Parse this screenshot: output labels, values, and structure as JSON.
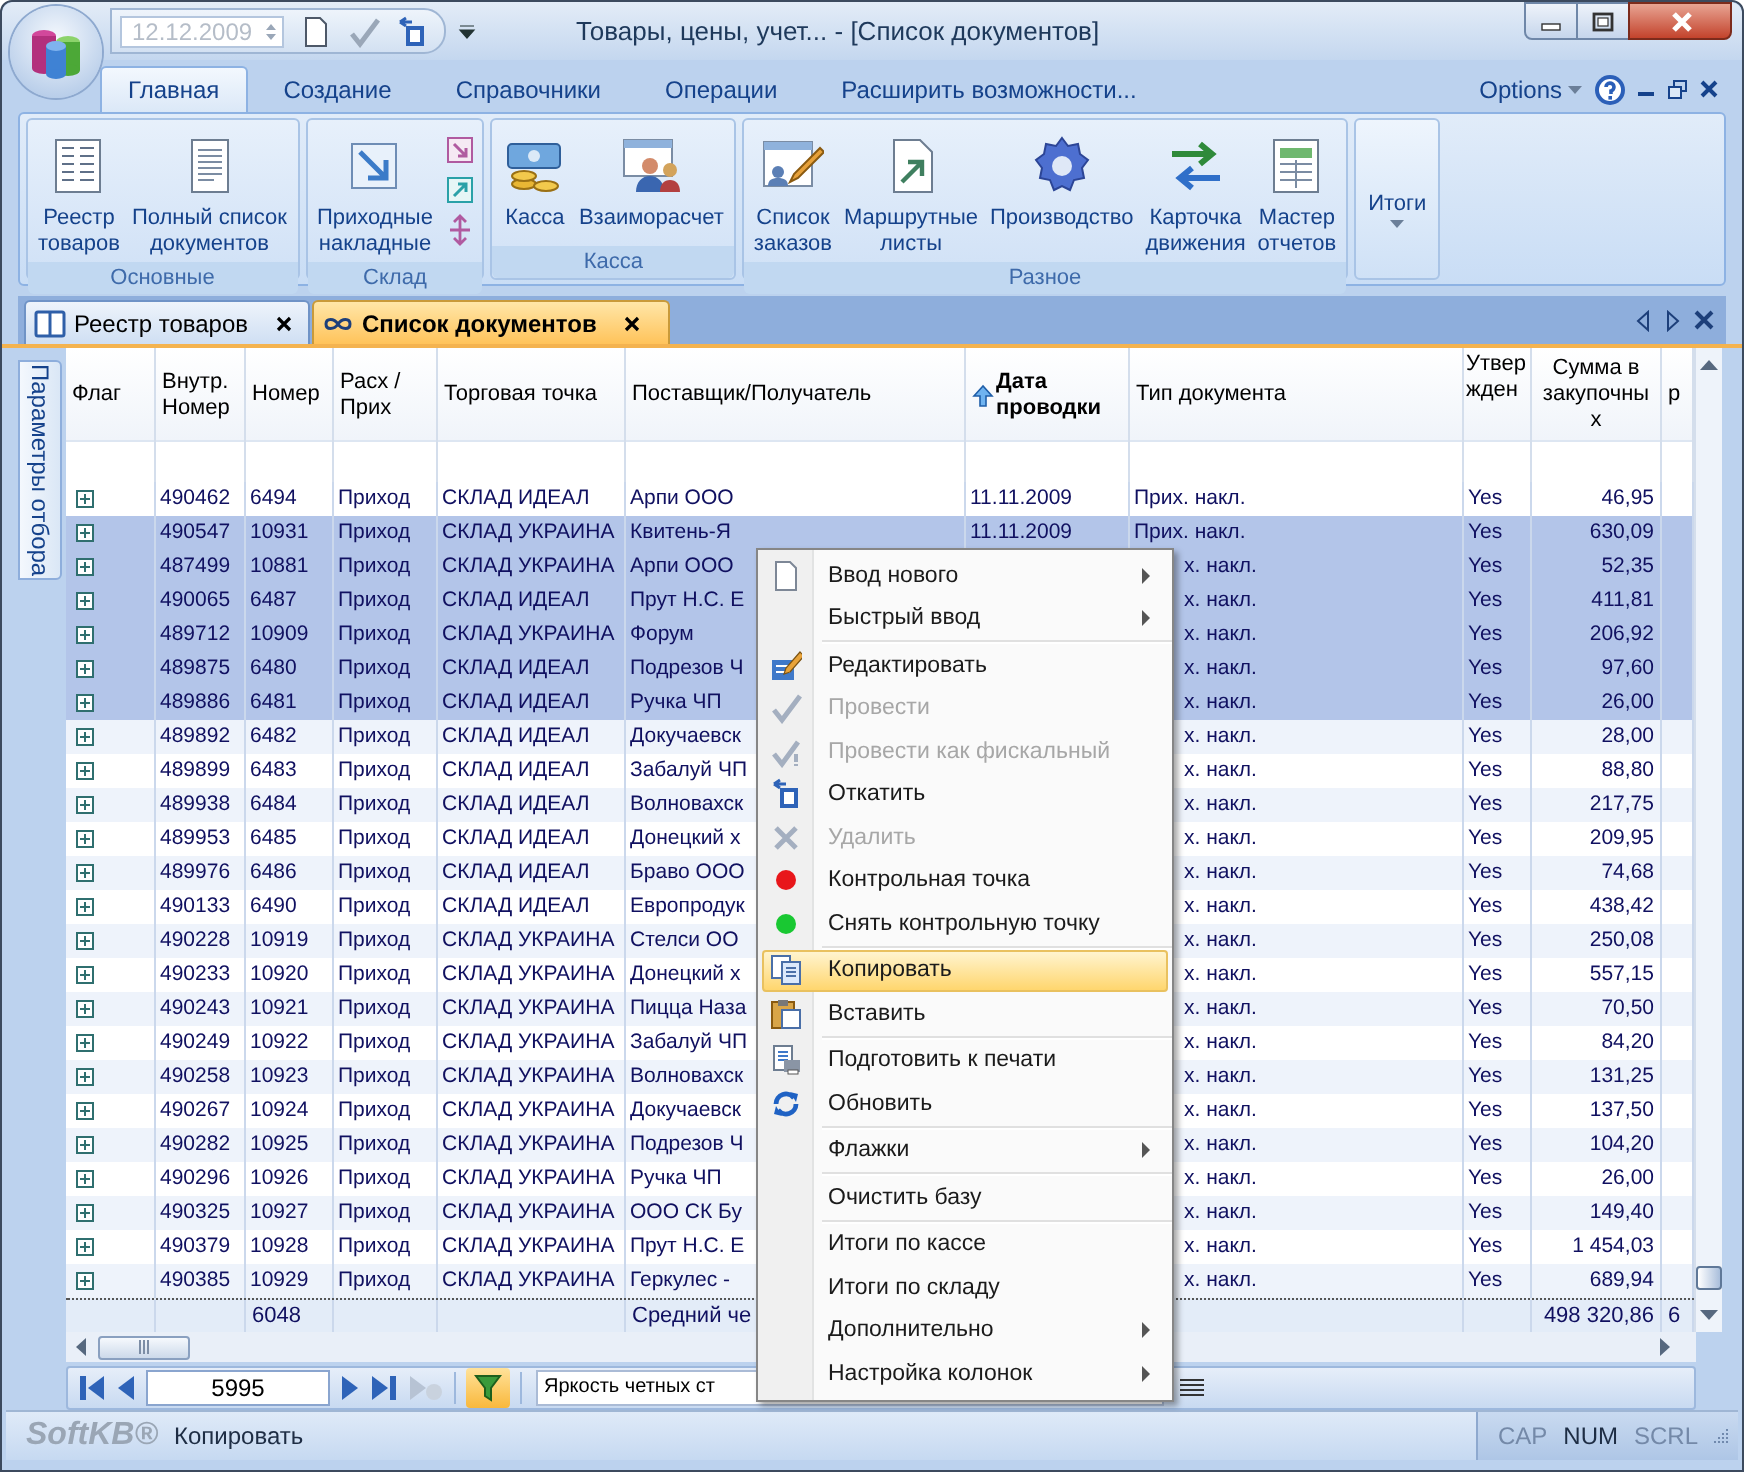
{
  "window": {
    "title": "Товары, цены, учет... - [Список документов]",
    "date_field": {
      "value": "12.12.2009",
      "disabled": true
    }
  },
  "ribbon": {
    "tabs": [
      {
        "label": "Главная",
        "selected": true
      },
      {
        "label": "Создание",
        "selected": false
      },
      {
        "label": "Справочники",
        "selected": false
      },
      {
        "label": "Операции",
        "selected": false
      },
      {
        "label": "Расширить возможности...",
        "selected": false
      }
    ],
    "options": "Options",
    "groups": [
      {
        "label": "Основные",
        "kind": "large",
        "buttons": [
          {
            "lines": [
              "Реестр",
              "товаров"
            ]
          },
          {
            "lines": [
              "Полный список",
              "документов"
            ]
          }
        ]
      },
      {
        "label": "Склад",
        "kind": "mixed",
        "buttons": [
          {
            "lines": [
              "Приходные",
              "накладные"
            ]
          }
        ]
      },
      {
        "label": "Касса",
        "kind": "large",
        "buttons": [
          {
            "lines": [
              "Касса"
            ]
          },
          {
            "lines": [
              "Взаиморасчет"
            ]
          }
        ]
      },
      {
        "label": "Разное",
        "kind": "large",
        "buttons": [
          {
            "lines": [
              "Список",
              "заказов"
            ]
          },
          {
            "lines": [
              "Маршрутные",
              "листы"
            ]
          },
          {
            "lines": [
              "Производство"
            ]
          },
          {
            "lines": [
              "Карточка",
              "движения"
            ]
          },
          {
            "lines": [
              "Мастер",
              "отчетов"
            ]
          }
        ]
      }
    ],
    "dropdown": {
      "label": "Итоги"
    }
  },
  "doc_tabs": [
    {
      "label": "Реестр товаров",
      "selected": false
    },
    {
      "label": "Список документов",
      "selected": true
    }
  ],
  "side_tab": "Параметры отбора",
  "table": {
    "columns": [
      {
        "label": "Флаг",
        "sorted": false
      },
      {
        "label": "Внутр. Номер",
        "sorted": false
      },
      {
        "label": "Номер",
        "sorted": false
      },
      {
        "label": "Расх / Прих",
        "sorted": false
      },
      {
        "label": "Торговая точка",
        "sorted": false
      },
      {
        "label": "Поставщик/Получатель",
        "sorted": false
      },
      {
        "label": "Дата проводки",
        "sorted": true
      },
      {
        "label": "Тип документа",
        "sorted": false
      },
      {
        "label": "Утвержден",
        "sorted": false
      },
      {
        "label": "Сумма в закупочных",
        "sorted": false
      },
      {
        "label": "р",
        "sorted": false
      }
    ],
    "rows": [
      {
        "selected": false,
        "internal_no": "490462",
        "number": "6494",
        "direction": "Приход",
        "store": "СКЛАД ИДЕАЛ",
        "partner": "Арпи ООО",
        "date": "11.11.2009",
        "doc_type": "Прих. накл.",
        "approved": "Yes",
        "sum": "46,95"
      },
      {
        "selected": true,
        "internal_no": "490547",
        "number": "10931",
        "direction": "Приход",
        "store": "СКЛАД УКРАИНА",
        "partner": "Квитень-Я",
        "date": "11.11.2009",
        "doc_type": "Прих. накл.",
        "approved": "Yes",
        "sum": "630,09"
      },
      {
        "selected": true,
        "internal_no": "487499",
        "number": "10881",
        "direction": "Приход",
        "store": "СКЛАД УКРАИНА",
        "partner": "Арпи ООО",
        "doc_type": "х. накл.",
        "approved": "Yes",
        "sum": "52,35"
      },
      {
        "selected": true,
        "internal_no": "490065",
        "number": "6487",
        "direction": "Приход",
        "store": "СКЛАД ИДЕАЛ",
        "partner": "Прут Н.С. Е",
        "doc_type": "х. накл.",
        "approved": "Yes",
        "sum": "411,81"
      },
      {
        "selected": true,
        "internal_no": "489712",
        "number": "10909",
        "direction": "Приход",
        "store": "СКЛАД УКРАИНА",
        "partner": "Форум",
        "doc_type": "х. накл.",
        "approved": "Yes",
        "sum": "206,92"
      },
      {
        "selected": true,
        "internal_no": "489875",
        "number": "6480",
        "direction": "Приход",
        "store": "СКЛАД ИДЕАЛ",
        "partner": "Подрезов Ч",
        "doc_type": "х. накл.",
        "approved": "Yes",
        "sum": "97,60"
      },
      {
        "selected": true,
        "internal_no": "489886",
        "number": "6481",
        "direction": "Приход",
        "store": "СКЛАД ИДЕАЛ",
        "partner": "Ручка ЧП",
        "doc_type": "х. накл.",
        "approved": "Yes",
        "sum": "26,00"
      },
      {
        "selected": false,
        "internal_no": "489892",
        "number": "6482",
        "direction": "Приход",
        "store": "СКЛАД ИДЕАЛ",
        "partner": "Докучаевск",
        "doc_type": "х. накл.",
        "approved": "Yes",
        "sum": "28,00"
      },
      {
        "selected": false,
        "internal_no": "489899",
        "number": "6483",
        "direction": "Приход",
        "store": "СКЛАД ИДЕАЛ",
        "partner": "Забалуй ЧП",
        "doc_type": "х. накл.",
        "approved": "Yes",
        "sum": "88,80"
      },
      {
        "selected": false,
        "internal_no": "489938",
        "number": "6484",
        "direction": "Приход",
        "store": "СКЛАД ИДЕАЛ",
        "partner": "Волновахск",
        "doc_type": "х. накл.",
        "approved": "Yes",
        "sum": "217,75"
      },
      {
        "selected": false,
        "internal_no": "489953",
        "number": "6485",
        "direction": "Приход",
        "store": "СКЛАД ИДЕАЛ",
        "partner": "Донецкий х",
        "doc_type": "х. накл.",
        "approved": "Yes",
        "sum": "209,95"
      },
      {
        "selected": false,
        "internal_no": "489976",
        "number": "6486",
        "direction": "Приход",
        "store": "СКЛАД ИДЕАЛ",
        "partner": "Браво ООО",
        "doc_type": "х. накл.",
        "approved": "Yes",
        "sum": "74,68"
      },
      {
        "selected": false,
        "internal_no": "490133",
        "number": "6490",
        "direction": "Приход",
        "store": "СКЛАД ИДЕАЛ",
        "partner": "Европродук",
        "doc_type": "х. накл.",
        "approved": "Yes",
        "sum": "438,42"
      },
      {
        "selected": false,
        "internal_no": "490228",
        "number": "10919",
        "direction": "Приход",
        "store": "СКЛАД УКРАИНА",
        "partner": "Стелси ОО",
        "doc_type": "х. накл.",
        "approved": "Yes",
        "sum": "250,08"
      },
      {
        "selected": false,
        "internal_no": "490233",
        "number": "10920",
        "direction": "Приход",
        "store": "СКЛАД УКРАИНА",
        "partner": "Донецкий х",
        "doc_type": "х. накл.",
        "approved": "Yes",
        "sum": "557,15"
      },
      {
        "selected": false,
        "internal_no": "490243",
        "number": "10921",
        "direction": "Приход",
        "store": "СКЛАД УКРАИНА",
        "partner": "Пицца Наза",
        "doc_type": "х. накл.",
        "approved": "Yes",
        "sum": "70,50"
      },
      {
        "selected": false,
        "internal_no": "490249",
        "number": "10922",
        "direction": "Приход",
        "store": "СКЛАД УКРАИНА",
        "partner": "Забалуй ЧП",
        "doc_type": "х. накл.",
        "approved": "Yes",
        "sum": "84,20"
      },
      {
        "selected": false,
        "internal_no": "490258",
        "number": "10923",
        "direction": "Приход",
        "store": "СКЛАД УКРАИНА",
        "partner": "Волновахск",
        "doc_type": "х. накл.",
        "approved": "Yes",
        "sum": "131,25"
      },
      {
        "selected": false,
        "internal_no": "490267",
        "number": "10924",
        "direction": "Приход",
        "store": "СКЛАД УКРАИНА",
        "partner": "Докучаевск",
        "doc_type": "х. накл.",
        "approved": "Yes",
        "sum": "137,50"
      },
      {
        "selected": false,
        "internal_no": "490282",
        "number": "10925",
        "direction": "Приход",
        "store": "СКЛАД УКРАИНА",
        "partner": "Подрезов Ч",
        "doc_type": "х. накл.",
        "approved": "Yes",
        "sum": "104,20"
      },
      {
        "selected": false,
        "internal_no": "490296",
        "number": "10926",
        "direction": "Приход",
        "store": "СКЛАД УКРАИНА",
        "partner": "Ручка ЧП",
        "doc_type": "х. накл.",
        "approved": "Yes",
        "sum": "26,00"
      },
      {
        "selected": false,
        "internal_no": "490325",
        "number": "10927",
        "direction": "Приход",
        "store": "СКЛАД УКРАИНА",
        "partner": "ООО СК Бу",
        "doc_type": "х. накл.",
        "approved": "Yes",
        "sum": "149,40"
      },
      {
        "selected": false,
        "internal_no": "490379",
        "number": "10928",
        "direction": "Приход",
        "store": "СКЛАД УКРАИНА",
        "partner": "Прут Н.С. Е",
        "doc_type": "х. накл.",
        "approved": "Yes",
        "sum": "1 454,03"
      },
      {
        "selected": false,
        "internal_no": "490385",
        "number": "10929",
        "direction": "Приход",
        "store": "СКЛАД УКРАИНА",
        "partner": "Геркулес -",
        "doc_type": "х. накл.",
        "approved": "Yes",
        "sum": "689,94"
      }
    ],
    "summary": {
      "number": "6048",
      "partner": "Средний че",
      "sum": "498 320,86",
      "column_11": "6"
    }
  },
  "nav_bar": {
    "record": "5995",
    "filter_on": true,
    "style_field": "Яркость четных ст"
  },
  "context_menu": [
    {
      "kind": "item",
      "label": "Ввод нового",
      "submenu": true,
      "disabled": false,
      "selected": false
    },
    {
      "kind": "item",
      "label": "Быстрый ввод",
      "submenu": true,
      "disabled": false,
      "selected": false
    },
    {
      "kind": "separator"
    },
    {
      "kind": "item",
      "label": "Редактировать",
      "submenu": false,
      "disabled": false,
      "selected": false
    },
    {
      "kind": "item",
      "label": "Провести",
      "submenu": false,
      "disabled": true,
      "selected": false
    },
    {
      "kind": "item",
      "label": "Провести как фискальный",
      "submenu": false,
      "disabled": true,
      "selected": false
    },
    {
      "kind": "item",
      "label": "Откатить",
      "submenu": false,
      "disabled": false,
      "selected": false
    },
    {
      "kind": "item",
      "label": "Удалить",
      "submenu": false,
      "disabled": true,
      "selected": false
    },
    {
      "kind": "item",
      "label": "Контрольная точка",
      "submenu": false,
      "disabled": false,
      "selected": false
    },
    {
      "kind": "item",
      "label": "Снять контрольную точку",
      "submenu": false,
      "disabled": false,
      "selected": false
    },
    {
      "kind": "separator"
    },
    {
      "kind": "item",
      "label": "Копировать",
      "submenu": false,
      "disabled": false,
      "selected": true
    },
    {
      "kind": "item",
      "label": "Вставить",
      "submenu": false,
      "disabled": false,
      "selected": false
    },
    {
      "kind": "separator"
    },
    {
      "kind": "item",
      "label": "Подготовить к печати",
      "submenu": false,
      "disabled": false,
      "selected": false
    },
    {
      "kind": "item",
      "label": "Обновить",
      "submenu": false,
      "disabled": false,
      "selected": false
    },
    {
      "kind": "separator"
    },
    {
      "kind": "item",
      "label": "Флажки",
      "submenu": true,
      "disabled": false,
      "selected": false
    },
    {
      "kind": "separator"
    },
    {
      "kind": "item",
      "label": "Очистить базу",
      "submenu": false,
      "disabled": false,
      "selected": false
    },
    {
      "kind": "separator"
    },
    {
      "kind": "item",
      "label": "Итоги по кассе",
      "submenu": false,
      "disabled": false,
      "selected": false
    },
    {
      "kind": "item",
      "label": "Итоги по складу",
      "submenu": false,
      "disabled": false,
      "selected": false
    },
    {
      "kind": "item",
      "label": "Дополнительно",
      "submenu": true,
      "disabled": false,
      "selected": false
    },
    {
      "kind": "item",
      "label": "Настройка колонок",
      "submenu": true,
      "disabled": false,
      "selected": false
    }
  ],
  "status_bar": {
    "logo": "SoftKB®",
    "message": "Копировать",
    "indicators": [
      {
        "label": "CAP",
        "on": false
      },
      {
        "label": "NUM",
        "on": true
      },
      {
        "label": "SCRL",
        "on": false
      }
    ]
  }
}
